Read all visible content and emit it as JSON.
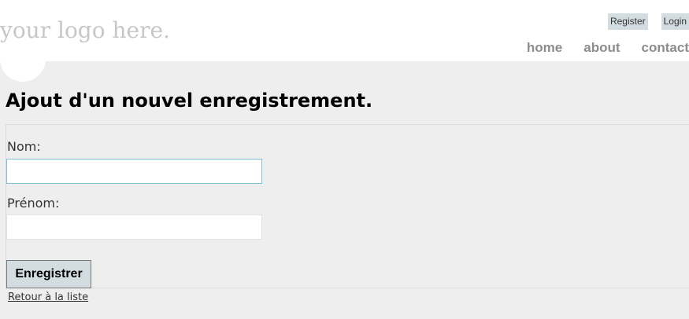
{
  "header": {
    "logo_text": "your logo here.",
    "login": {
      "register": "Register",
      "login": "Login"
    },
    "menu": [
      "home",
      "about",
      "contact"
    ]
  },
  "main": {
    "title": "Ajout d'un nouvel enregistrement.",
    "form": {
      "fields": [
        {
          "label": "Nom:",
          "value": ""
        },
        {
          "label": "Prénom:",
          "value": ""
        }
      ],
      "submit_label": "Enregistrer"
    },
    "back_link": "Retour à la liste"
  },
  "colors": {
    "header_bg": "#ffffff",
    "main_bg": "#efeeef",
    "button_bg": "#d3dce0",
    "focus_border": "#7ac0da",
    "menu_text": "#8c8c8c",
    "logo_text": "#c7c7c7"
  }
}
